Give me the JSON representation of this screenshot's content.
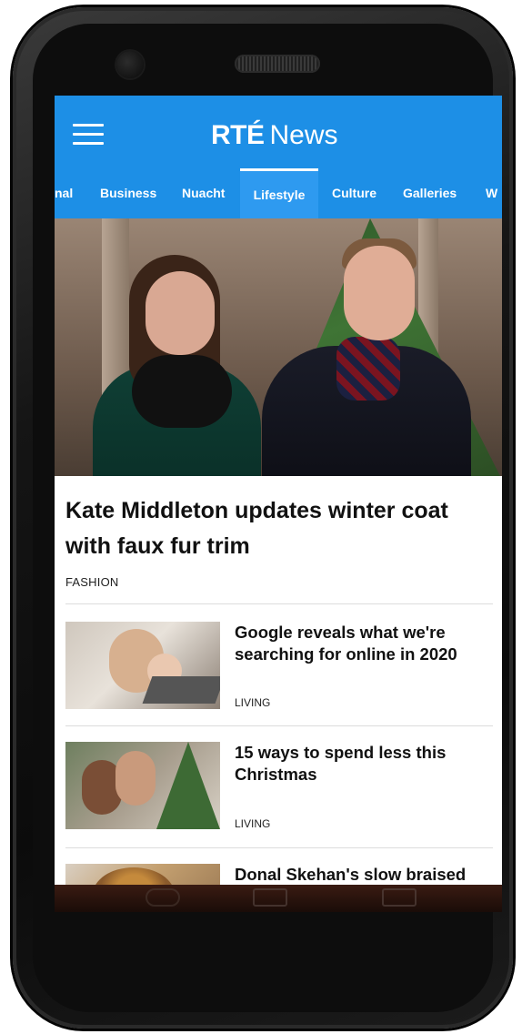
{
  "app": {
    "brand_bold": "RTÉ",
    "brand_light": "News"
  },
  "tabs": [
    {
      "label": "nal"
    },
    {
      "label": "Business"
    },
    {
      "label": "Nuacht"
    },
    {
      "label": "Lifestyle",
      "active": true
    },
    {
      "label": "Culture"
    },
    {
      "label": "Galleries"
    },
    {
      "label": "W"
    }
  ],
  "lead_story": {
    "headline": "Kate Middleton updates winter coat with faux fur trim",
    "category": "FASHION"
  },
  "stories": [
    {
      "title": "Google reveals what we're searching for online in 2020",
      "category": "LIVING"
    },
    {
      "title": "15 ways to spend less this Christmas",
      "category": "LIVING"
    },
    {
      "title": "Donal Skehan's slow braised",
      "category": ""
    }
  ],
  "colors": {
    "accent": "#1d8fe6",
    "active_tab": "#2e9af0",
    "text": "#111111"
  }
}
